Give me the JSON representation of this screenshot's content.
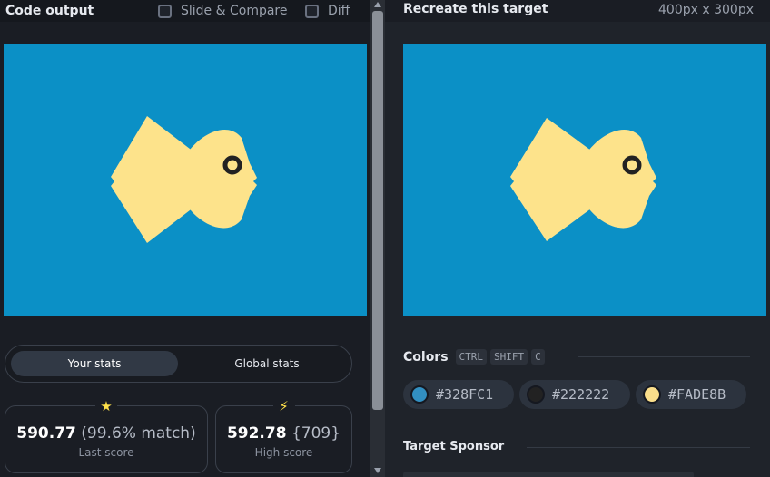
{
  "left_panel": {
    "title": "Code output",
    "slide_compare": {
      "label": "Slide & Compare",
      "checked": false
    },
    "diff": {
      "label": "Diff",
      "checked": false
    }
  },
  "stats": {
    "tabs": [
      {
        "label": "Your stats",
        "active": true
      },
      {
        "label": "Global stats",
        "active": false
      }
    ],
    "last": {
      "icon": "star-icon",
      "score": "590.77",
      "detail": "(99.6% match)",
      "caption": "Last score"
    },
    "high": {
      "icon": "lightning-icon",
      "score": "592.78",
      "detail": "{709}",
      "caption": "High score"
    }
  },
  "right_panel": {
    "title": "Recreate this target",
    "dimensions": "400px x 300px",
    "colors_label": "Colors",
    "shortcut_keys": [
      "CTRL",
      "SHIFT",
      "C"
    ],
    "colors": [
      {
        "hex": "#328FC1",
        "swatch": "#328fc1"
      },
      {
        "hex": "#222222",
        "swatch": "#222222"
      },
      {
        "hex": "#FADE8B",
        "swatch": "#fade8b"
      }
    ],
    "sponsor_label": "Target Sponsor"
  },
  "theme": {
    "canvas_bg": "#0b90c6",
    "fish_color": "#fde38b",
    "eye_color": "#222222"
  }
}
